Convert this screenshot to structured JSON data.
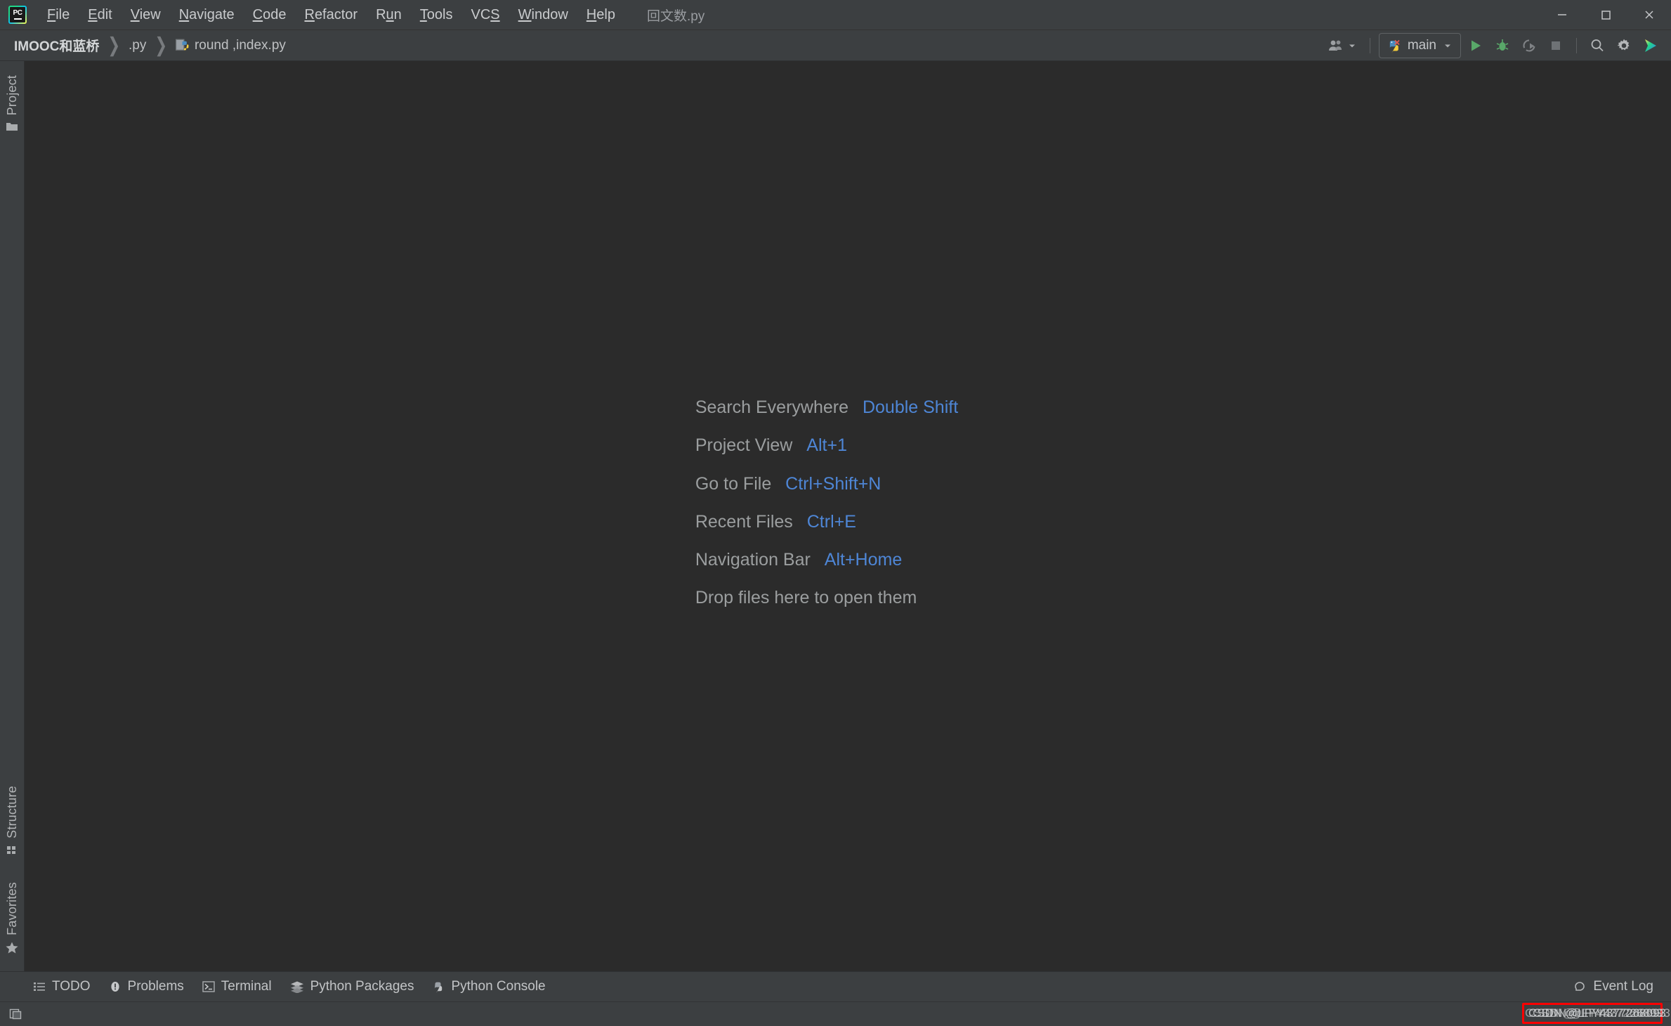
{
  "window": {
    "app_name": "PyCharm",
    "logo_text": "PC",
    "active_file_title": "回文数.py",
    "minimize_label": "Minimize",
    "maximize_label": "Maximize",
    "close_label": "Close"
  },
  "menubar": {
    "items": [
      {
        "label": "File",
        "mnemonic": "F"
      },
      {
        "label": "Edit",
        "mnemonic": "E"
      },
      {
        "label": "View",
        "mnemonic": "V"
      },
      {
        "label": "Navigate",
        "mnemonic": "N"
      },
      {
        "label": "Code",
        "mnemonic": "C"
      },
      {
        "label": "Refactor",
        "mnemonic": "R"
      },
      {
        "label": "Run",
        "mnemonic": "u"
      },
      {
        "label": "Tools",
        "mnemonic": "T"
      },
      {
        "label": "VCS",
        "mnemonic": "S"
      },
      {
        "label": "Window",
        "mnemonic": "W"
      },
      {
        "label": "Help",
        "mnemonic": "H"
      }
    ]
  },
  "navbar": {
    "breadcrumbs": [
      {
        "label": "IMOOC和蓝桥",
        "icon": "",
        "is_root": true
      },
      {
        "label": ".py",
        "icon": "",
        "is_root": false
      },
      {
        "label": "round ,index.py",
        "icon": "python-file-icon",
        "is_root": false
      }
    ],
    "separator": "❯",
    "toolbar": {
      "users_icon": "users-icon",
      "users_dropdown_icon": "chevron-down-icon",
      "run_config": {
        "icon": "python-run-config-icon",
        "label": "main",
        "dropdown_icon": "chevron-down-icon"
      },
      "run_button": "run-icon",
      "debug_button": "debug-icon",
      "coverage_button": "run-with-coverage-icon",
      "stop_button": "stop-icon",
      "search_button": "search-icon",
      "settings_button": "gear-icon",
      "updates_button": "updates-icon"
    }
  },
  "left_stripe": {
    "top_items": [
      {
        "label": "Project",
        "icon": "folder-icon"
      }
    ],
    "bottom_items": [
      {
        "label": "Structure",
        "icon": "structure-icon"
      },
      {
        "label": "Favorites",
        "icon": "star-icon"
      }
    ]
  },
  "editor": {
    "hints": [
      {
        "action": "Search Everywhere",
        "shortcut": "Double Shift"
      },
      {
        "action": "Project View",
        "shortcut": "Alt+1"
      },
      {
        "action": "Go to File",
        "shortcut": "Ctrl+Shift+N"
      },
      {
        "action": "Recent Files",
        "shortcut": "Ctrl+E"
      },
      {
        "action": "Navigation Bar",
        "shortcut": "Alt+Home"
      },
      {
        "action": "Drop files here to open them",
        "shortcut": ""
      }
    ],
    "background_color": "#2b2b2b",
    "hint_text_color": "#9b9e9f",
    "hint_shortcut_color": "#4e86d6"
  },
  "bottom_tool_windows": {
    "items": [
      {
        "label": "TODO",
        "icon": "todo-list-icon"
      },
      {
        "label": "Problems",
        "icon": "problems-icon"
      },
      {
        "label": "Terminal",
        "icon": "terminal-icon"
      },
      {
        "label": "Python Packages",
        "icon": "packages-icon"
      },
      {
        "label": "Python Console",
        "icon": "python-console-icon"
      }
    ],
    "event_log": {
      "label": "Event Log",
      "icon": "event-log-icon"
    }
  },
  "status_bar": {
    "layout_toggle_icon": "tool-windows-layout-icon"
  },
  "watermark": {
    "lines": [
      "CSDN @LFY4377268093",
      "CSDN @LFY4377268093",
      "CSDN @LFY4377268093"
    ],
    "border_color": "#ff0000"
  },
  "theme": {
    "chrome_bg": "#3c3f41",
    "editor_bg": "#2b2b2b",
    "text": "#bbbbbb",
    "accent_blue": "#4e86d6",
    "run_green": "#59a869"
  }
}
